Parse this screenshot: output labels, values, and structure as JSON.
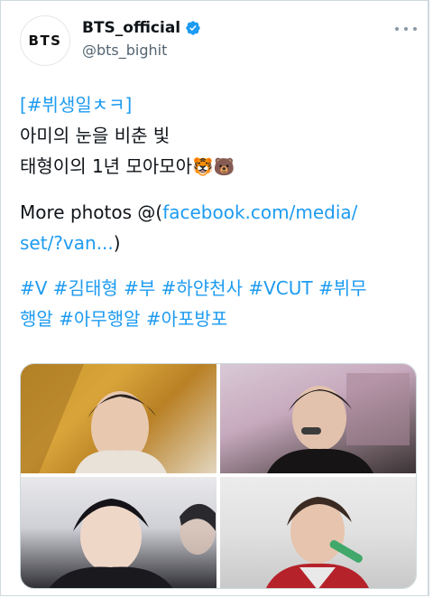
{
  "account": {
    "avatar_text": "BTS",
    "display_name": "BTS_official",
    "handle": "@bts_bighit"
  },
  "tweet": {
    "line1": "[#뷔생일ㅊㅋ]",
    "line2": "아미의 눈을 비춘 빛",
    "line3_text": "태형이의 1년 모아모아",
    "line3_emojis": "🐯🐻",
    "line4_prefix": "More photos @(",
    "line4_link": "facebook.com/media/",
    "line5_link": "set/?van...",
    "line5_suffix": ")",
    "hashtags_line1": "#V #김태형 #부 #하얀천사 #VCUT #뷔무",
    "hashtags_line2": "행알 #아무행알 #아포방포"
  },
  "media": {
    "photos": [
      "photo-1",
      "photo-2",
      "photo-3",
      "photo-4"
    ]
  },
  "colors": {
    "link": "#1d9bf0",
    "verified": "#1d9bf0",
    "secondary_text": "#536471"
  },
  "icons": [
    "verified-badge-icon",
    "more-options-icon"
  ]
}
